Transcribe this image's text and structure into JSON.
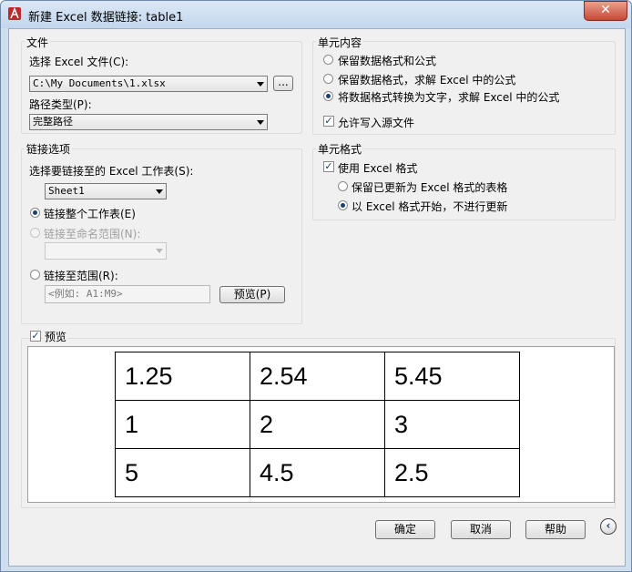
{
  "window": {
    "title": "新建 Excel 数据链接: table1",
    "close_label": "✕"
  },
  "file_group": {
    "title": "文件",
    "select_label": "选择 Excel 文件(C):",
    "file_path": "C:\\My Documents\\1.xlsx",
    "browse_label": "...",
    "path_type_label": "路径类型(P):",
    "path_type_value": "完整路径"
  },
  "link_group": {
    "title": "链接选项",
    "sheet_label": "选择要链接至的 Excel 工作表(S):",
    "sheet_value": "Sheet1",
    "opt_whole_sheet": "链接整个工作表(E)",
    "opt_named_range": "链接至命名范围(N):",
    "opt_range": "链接至范围(R):",
    "range_placeholder": "<例如: A1:M9>",
    "preview_btn": "预览(P)"
  },
  "cell_content": {
    "title": "单元内容",
    "opt1": "保留数据格式和公式",
    "opt2": "保留数据格式，求解 Excel 中的公式",
    "opt3": "将数据格式转换为文字，求解 Excel 中的公式",
    "allow_write": "允许写入源文件"
  },
  "cell_format": {
    "title": "单元格式",
    "use_excel": "使用 Excel 格式",
    "keep_updated": "保留已更新为 Excel 格式的表格",
    "start_excel": "以 Excel 格式开始，不进行更新"
  },
  "preview": {
    "label": "预览",
    "rows": [
      [
        "1.25",
        "2.54",
        "5.45"
      ],
      [
        "1",
        "2",
        "3"
      ],
      [
        "5",
        "4.5",
        "2.5"
      ]
    ]
  },
  "buttons": {
    "ok": "确定",
    "cancel": "取消",
    "help": "帮助"
  }
}
